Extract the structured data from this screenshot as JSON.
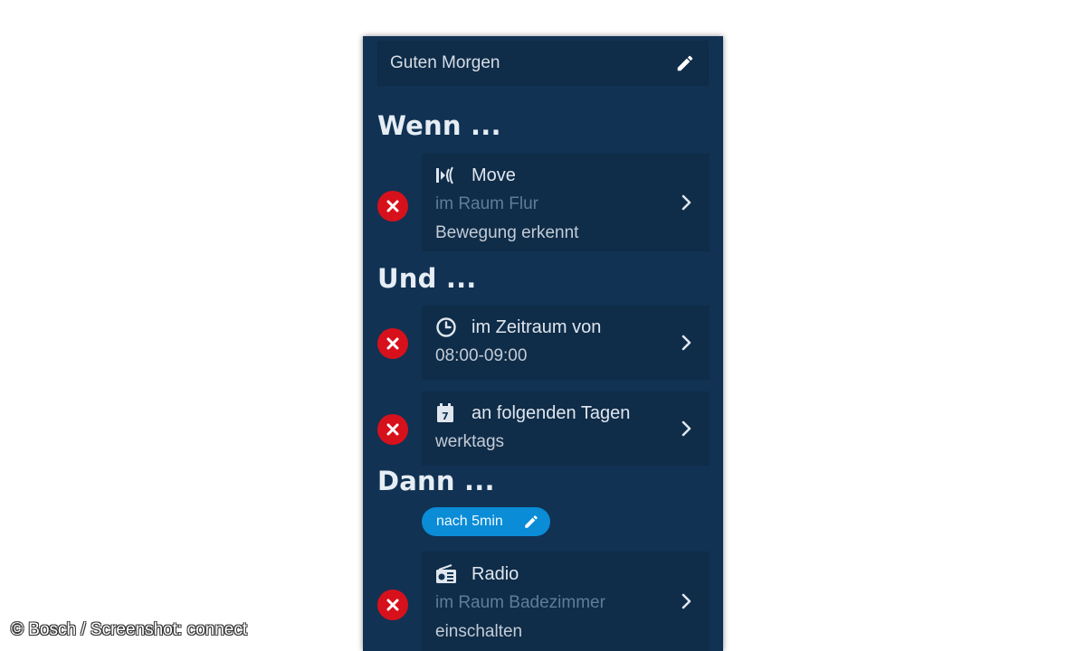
{
  "rule_name": "Guten Morgen",
  "sections": {
    "when": "Wenn ...",
    "and": "Und ...",
    "then": "Dann ..."
  },
  "triggers": [
    {
      "icon": "motion-sensor-icon",
      "title": "Move",
      "room": "im Raum Flur",
      "state": "Bewegung erkennt"
    }
  ],
  "conditions": [
    {
      "icon": "clock-icon",
      "title": "im Zeitraum von",
      "value": "08:00-09:00"
    },
    {
      "icon": "calendar-icon",
      "title": "an folgenden Tagen",
      "value": "werktags"
    }
  ],
  "delay_label": "nach 5min",
  "actions": [
    {
      "icon": "radio-icon",
      "title": "Radio",
      "room": "im Raum Badezimmer",
      "state": "einschalten"
    }
  ],
  "copyright": "© Bosch / Screenshot: connect",
  "colors": {
    "background": "#113253",
    "card": "#0f2c48",
    "remove_button": "#d7111c",
    "delay_pill": "#0a8cd6"
  }
}
